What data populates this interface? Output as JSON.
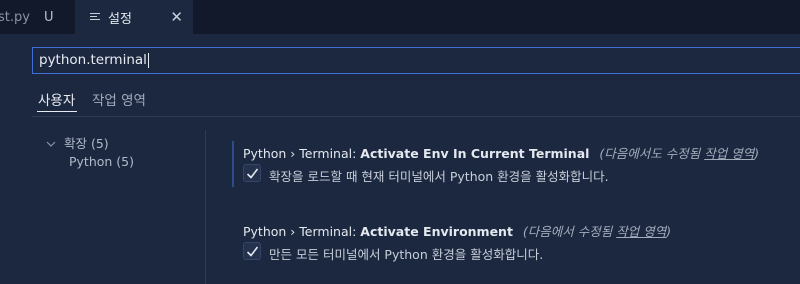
{
  "tabs": [
    {
      "name": "st.py",
      "status": "U"
    },
    {
      "name": "설정",
      "icon": "settings-lines-icon"
    }
  ],
  "search": {
    "value": "python.terminal"
  },
  "scope_tabs": {
    "user": "사용자",
    "workspace": "작업 영역"
  },
  "tree": {
    "extensions": "확장 (5)",
    "python": "Python (5)"
  },
  "settings": [
    {
      "category": "Python › Terminal: ",
      "name": "Activate Env In Current Terminal",
      "scope_prefix": "(다음에서도 수정됨 ",
      "scope_link": "작업 영역",
      "scope_suffix": ")",
      "checked": true,
      "description": "확장을 로드할 때 현재 터미널에서 Python 환경을 활성화합니다."
    },
    {
      "category": "Python › Terminal: ",
      "name": "Activate Environment",
      "scope_prefix": "(다음에서 수정됨 ",
      "scope_link": "작업 영역",
      "scope_suffix": ")",
      "checked": true,
      "description": "만든 모든 터미널에서 Python 환경을 활성화합니다."
    }
  ],
  "colors": {
    "accent": "#3f6ed6",
    "background": "#1b2840",
    "tabbar": "#12192a"
  }
}
